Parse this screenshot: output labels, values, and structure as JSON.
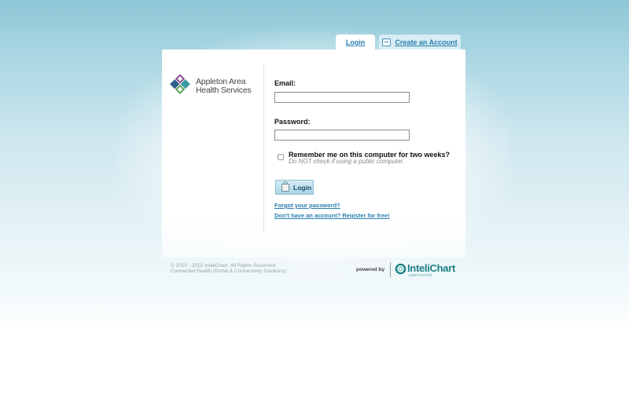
{
  "tabs": {
    "login_label": "Login",
    "create_account_label": "Create an Account"
  },
  "brand": {
    "name_line1": "Appleton Area",
    "name_line2": "Health Services"
  },
  "form": {
    "email_label": "Email:",
    "email_value": "",
    "password_label": "Password:",
    "password_value": "",
    "remember_label": "Remember me on this computer for two weeks?",
    "remember_hint": "Do NOT check if using a public computer.",
    "remember_checked": false,
    "login_button_label": "Login",
    "forgot_link": "Forgot your password?",
    "register_link": "Don't have an account? Register for free!"
  },
  "footer": {
    "copyright_line1": "© 2010 - 2015 InteliChart. All Rights Reserved.",
    "copyright_line2": "Connected Health (Portal & Connectivity Solutions)",
    "powered_by": "powered by",
    "vendor_name": "InteliChart",
    "vendor_sub": "patient portal"
  },
  "icons": {
    "tab_create": "id-card-icon",
    "login_button": "lock-icon",
    "brand_logo": "diamond-cross-logo"
  },
  "colors": {
    "link": "#2a7fb0",
    "button_bg": "#a9d3e4",
    "vendor_teal": "#1e7f82",
    "logo_purple": "#8a4f8f",
    "logo_blue": "#2d5f8a",
    "logo_teal": "#3a9a9b",
    "logo_green": "#5aa55a"
  }
}
